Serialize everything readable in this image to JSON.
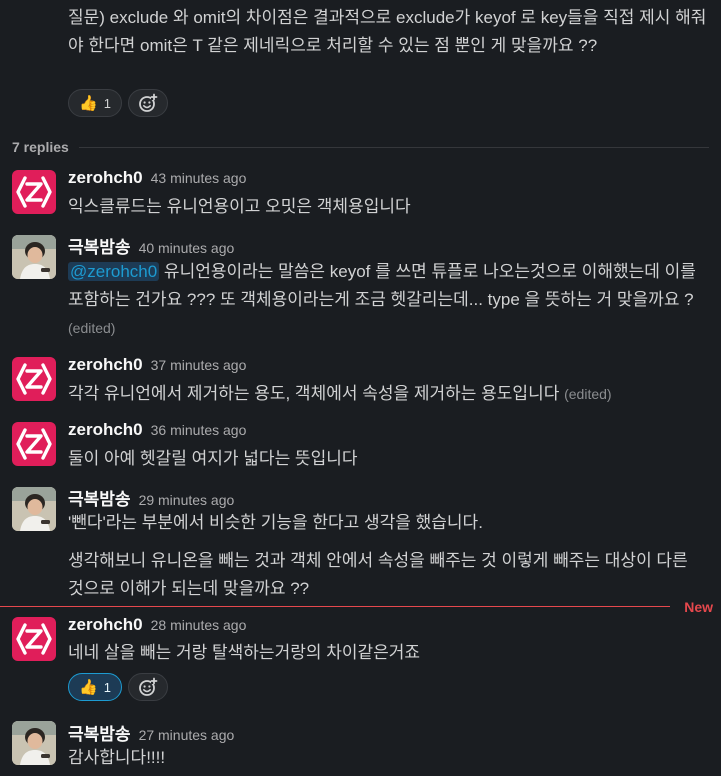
{
  "parent": {
    "text": "질문) exclude 와 omit의 차이점은 결과적으로 exclude가 keyof 로 key들을 직접 제시 해줘야 한다면 omit은 T 같은 제네릭으로 처리할 수 있는 점 뿐인 게 맞을까요 ??",
    "reaction_emoji": "👍",
    "reaction_count": "1"
  },
  "thread": {
    "replies_label": "7 replies",
    "new_label": "New"
  },
  "messages": [
    {
      "author": "zerohch0",
      "time": "43 minutes ago",
      "text": "익스클류드는 유니언용이고 오밋은 객체용입니다"
    },
    {
      "author": "극복밤송",
      "time": "40 minutes ago",
      "mention": "@zerohch0",
      "text": " 유니언용이라는 말씀은 keyof 를 쓰면 튜플로 나오는것으로 이해했는데 이를 포함하는 건가요 ??? 또 객체용이라는게 조금 헷갈리는데... type 을 뜻하는 거 맞을까요 ?",
      "edited": "(edited)"
    },
    {
      "author": "zerohch0",
      "time": "37 minutes ago",
      "text": "각각 유니언에서 제거하는 용도, 객체에서 속성을 제거하는 용도입니다",
      "edited": "(edited)"
    },
    {
      "author": "zerohch0",
      "time": "36 minutes ago",
      "text": "둘이 아예 헷갈릴 여지가 넓다는 뜻입니다"
    },
    {
      "author": "극복밤송",
      "time": "29 minutes ago",
      "text": "'뺀다'라는 부분에서 비슷한 기능을 한다고 생각을 했습니다.",
      "text2": "생각해보니 유니온을 빼는 것과 객체 안에서 속성을 빼주는 것 이렇게 빼주는 대상이 다른 것으로 이해가 되는데 맞을까요 ??"
    },
    {
      "author": "zerohch0",
      "time": "28 minutes ago",
      "text": "네네 살을 빼는 거랑 탈색하는거랑의 차이같은거죠",
      "reaction_emoji": "👍",
      "reaction_count": "1"
    },
    {
      "author": "극복밤송",
      "time": "27 minutes ago",
      "text": "감사합니다!!!!"
    }
  ],
  "colors": {
    "accent": "#1d9bd1",
    "new": "#e5484d",
    "avatar_z": "#e01e5a"
  },
  "icons": {
    "z_avatar": "z-logo-icon",
    "add_reaction": "add-reaction-icon",
    "thumbs_up": "thumbs-up-icon"
  }
}
